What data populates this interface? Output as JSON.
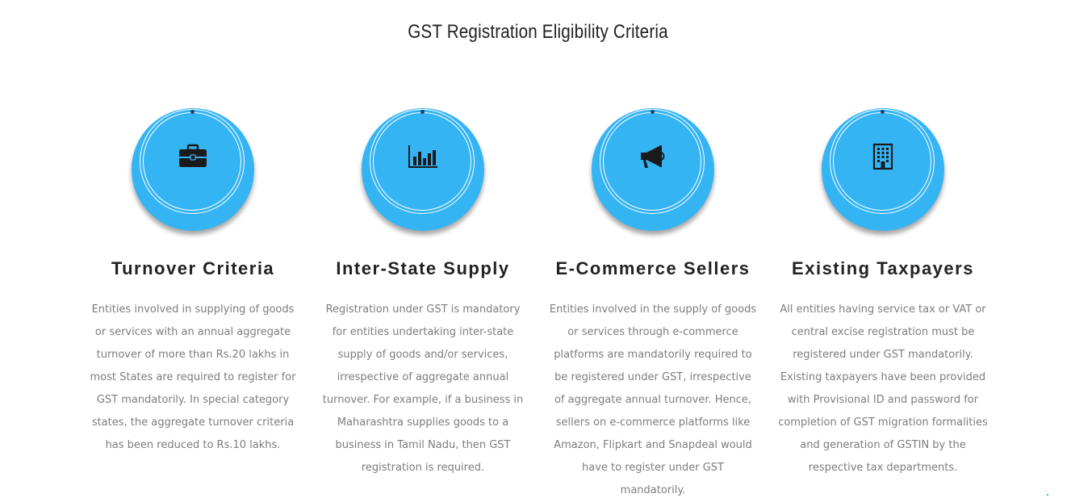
{
  "section": {
    "title": "GST Registration Eligibility Criteria"
  },
  "colors": {
    "circle": "#35b4f4",
    "icon": "#1a1a1a",
    "title": "#222222",
    "body_text": "#7d7d7d"
  },
  "cards": [
    {
      "icon": "briefcase-icon",
      "title": "Turnover Criteria",
      "text": "Entities involved in supplying of goods or services with an annual aggregate turnover of more than Rs.20 lakhs in most States are required to register for GST mandatorily. In special category states, the aggregate turnover criteria has been reduced to Rs.10 lakhs."
    },
    {
      "icon": "bar-chart-icon",
      "title": "Inter-State Supply",
      "text": "Registration under GST is mandatory for entities undertaking inter-state supply of goods and/or services, irrespective of aggregate annual turnover. For example, if a business in Maharashtra supplies goods to a business in Tamil Nadu, then GST registration is required."
    },
    {
      "icon": "megaphone-icon",
      "title": "E-Commerce Sellers",
      "text": "Entities involved in the supply of goods or services through e-commerce platforms are mandatorily required to be registered under GST, irrespective of aggregate annual turnover. Hence, sellers on e-commerce platforms like Amazon, Flipkart and Snapdeal would have to register under GST mandatorily."
    },
    {
      "icon": "building-icon",
      "title": "Existing Taxpayers",
      "text": "All entities having service tax or VAT or central excise registration must be registered under GST mandatorily. Existing taxpayers have been provided with Provisional ID and password for completion of GST migration formalities and generation of GSTIN by the respective tax departments."
    }
  ]
}
